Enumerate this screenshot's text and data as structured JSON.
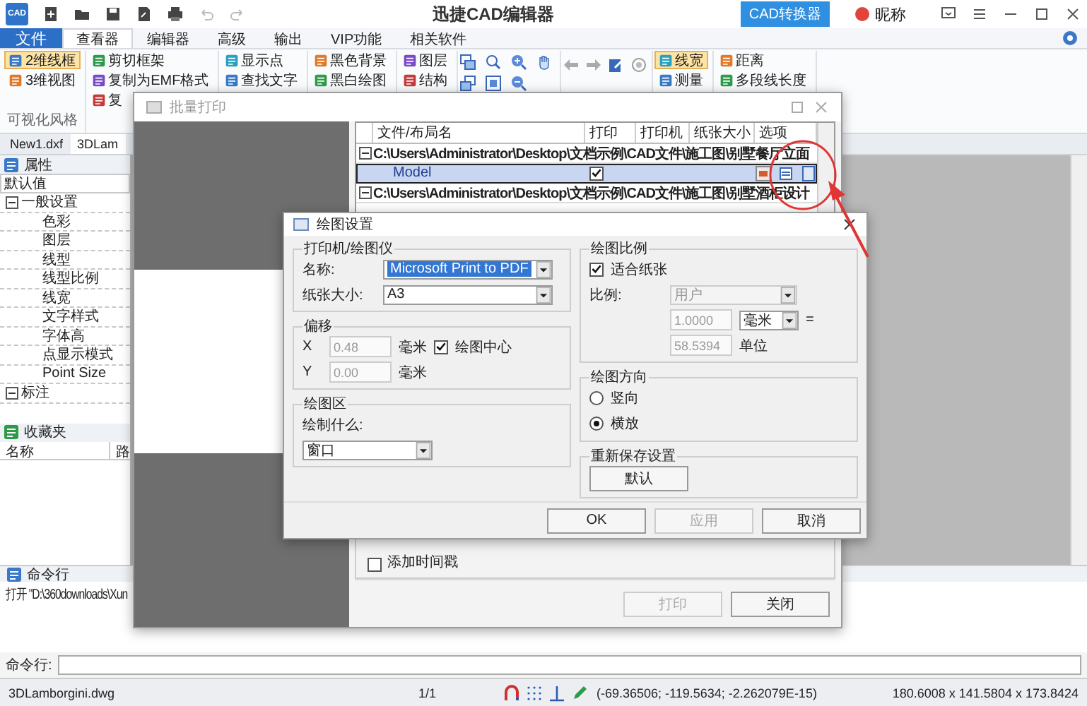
{
  "title_bar": {
    "logo": "CAD",
    "title": "迅捷CAD编辑器",
    "converter_button": "CAD转换器",
    "user_name": "昵称"
  },
  "menu_tabs": [
    {
      "label": "文件",
      "kind": "file",
      "selected": false
    },
    {
      "label": "查看器",
      "kind": "tab",
      "selected": true
    },
    {
      "label": "编辑器",
      "kind": "tab",
      "selected": false
    },
    {
      "label": "高级",
      "kind": "tab",
      "selected": false
    },
    {
      "label": "输出",
      "kind": "tab",
      "selected": false
    },
    {
      "label": "VIP功能",
      "kind": "tab",
      "selected": false
    },
    {
      "label": "相关软件",
      "kind": "tab",
      "selected": false
    }
  ],
  "ribbon": {
    "groups": [
      {
        "kind": "buttons",
        "label": "可视化风格",
        "buttons": [
          {
            "label": "2维线框",
            "selected": true
          },
          {
            "label": "3维视图",
            "selected": false
          }
        ]
      },
      {
        "kind": "buttons",
        "buttons": [
          {
            "label": "剪切框架",
            "selected": false
          },
          {
            "label": "复制为EMF格式",
            "selected": false
          },
          {
            "label": "复",
            "selected": false
          }
        ]
      },
      {
        "kind": "buttons",
        "buttons": [
          {
            "label": "显示点",
            "selected": false
          },
          {
            "label": "查找文字",
            "selected": false
          }
        ]
      },
      {
        "kind": "buttons",
        "buttons": [
          {
            "label": "黑色背景",
            "selected": false
          },
          {
            "label": "黑白绘图",
            "selected": false
          }
        ]
      },
      {
        "kind": "buttons",
        "buttons": [
          {
            "label": "图层",
            "selected": false
          },
          {
            "label": "结构",
            "selected": false
          }
        ]
      },
      {
        "kind": "tools"
      },
      {
        "kind": "navigation"
      },
      {
        "kind": "buttons",
        "buttons": [
          {
            "label": "线宽",
            "selected": true
          },
          {
            "label": "测量",
            "selected": false
          }
        ]
      },
      {
        "kind": "buttons",
        "buttons": [
          {
            "label": "距离",
            "selected": false
          },
          {
            "label": "多段线长度",
            "selected": false
          }
        ]
      }
    ]
  },
  "document_tabs": [
    {
      "label": "New1.dxf",
      "selected": false
    },
    {
      "label": "3DLam",
      "selected": true
    }
  ],
  "properties_panel": {
    "title": "属性",
    "value": "默认值",
    "tree": [
      {
        "label": "一般设置",
        "expanded": true,
        "children": [
          {
            "label": "色彩"
          },
          {
            "label": "图层"
          },
          {
            "label": "线型"
          },
          {
            "label": "线型比例"
          },
          {
            "label": "线宽"
          },
          {
            "label": "文字样式"
          },
          {
            "label": "字体高"
          },
          {
            "label": "点显示模式"
          },
          {
            "label": "Point Size"
          }
        ]
      },
      {
        "label": "标注",
        "expanded": true
      }
    ]
  },
  "favorites_panel": {
    "title": "收藏夹",
    "columns": [
      "名称",
      "路"
    ]
  },
  "command_panel": {
    "title": "命令行",
    "output": "打开 \"D:\\360downloads\\Xun",
    "prompt": "命令行:"
  },
  "status_bar": {
    "file": "3DLamborgini.dwg",
    "page": "1/1",
    "coordinates": "(-69.36506; -119.5634; -2.262079E-15)",
    "dimensions": "180.6008 x 141.5804 x 173.8424"
  },
  "batch_print_dialog": {
    "title": "批量打印",
    "columns": [
      "文件/布局名",
      "打印",
      "打印机",
      "纸张大小",
      "选项"
    ],
    "rows": [
      {
        "kind": "file",
        "name": "C:\\Users\\Administrator\\Desktop\\文档示例\\CAD文件\\施工图\\别墅餐厅立面",
        "selected": false
      },
      {
        "kind": "layout",
        "name": "Model",
        "print": true,
        "selected": true
      },
      {
        "kind": "file",
        "name": "C:\\Users\\Administrator\\Desktop\\文档示例\\CAD文件\\施工图\\别墅酒柜设计",
        "selected": false
      }
    ],
    "timestamp_label": "添加时间戳",
    "timestamp_checked": false,
    "buttons": [
      {
        "label": "打印",
        "disabled": true
      },
      {
        "label": "关闭",
        "disabled": false
      }
    ]
  },
  "plot_settings_dialog": {
    "title": "绘图设置",
    "printer_group": {
      "title": "打印机/绘图仪",
      "name_label": "名称:",
      "name_value": "Microsoft Print to PDF",
      "name_text_selected": true,
      "paper_label": "纸张大小:",
      "paper_value": "A3"
    },
    "offset_group": {
      "title": "偏移",
      "x_label": "X",
      "x_value": "0.48",
      "x_unit": "毫米",
      "center_label": "绘图中心",
      "center_checked": true,
      "y_label": "Y",
      "y_value": "0.00",
      "y_unit": "毫米",
      "disabled": true
    },
    "area_group": {
      "title": "绘图区",
      "what_label": "绘制什么:",
      "what_value": "窗口"
    },
    "scale_group": {
      "title": "绘图比例",
      "fit_label": "适合纸张",
      "fit_checked": true,
      "scale_label": "比例:",
      "scale_value": "用户",
      "paper_units_value": "1.0000",
      "unit_value": "毫米",
      "equals": "=",
      "drawing_units_value": "58.5394",
      "drawing_units_label": "单位",
      "disabled": true
    },
    "orientation_group": {
      "title": "绘图方向",
      "options": [
        {
          "label": "竖向",
          "selected": false
        },
        {
          "label": "横放",
          "selected": true
        }
      ]
    },
    "reset_group": {
      "title": "重新保存设置",
      "button": "默认"
    },
    "buttons": [
      {
        "label": "OK",
        "disabled": false
      },
      {
        "label": "应用",
        "disabled": true
      },
      {
        "label": "取消",
        "disabled": false
      }
    ]
  }
}
